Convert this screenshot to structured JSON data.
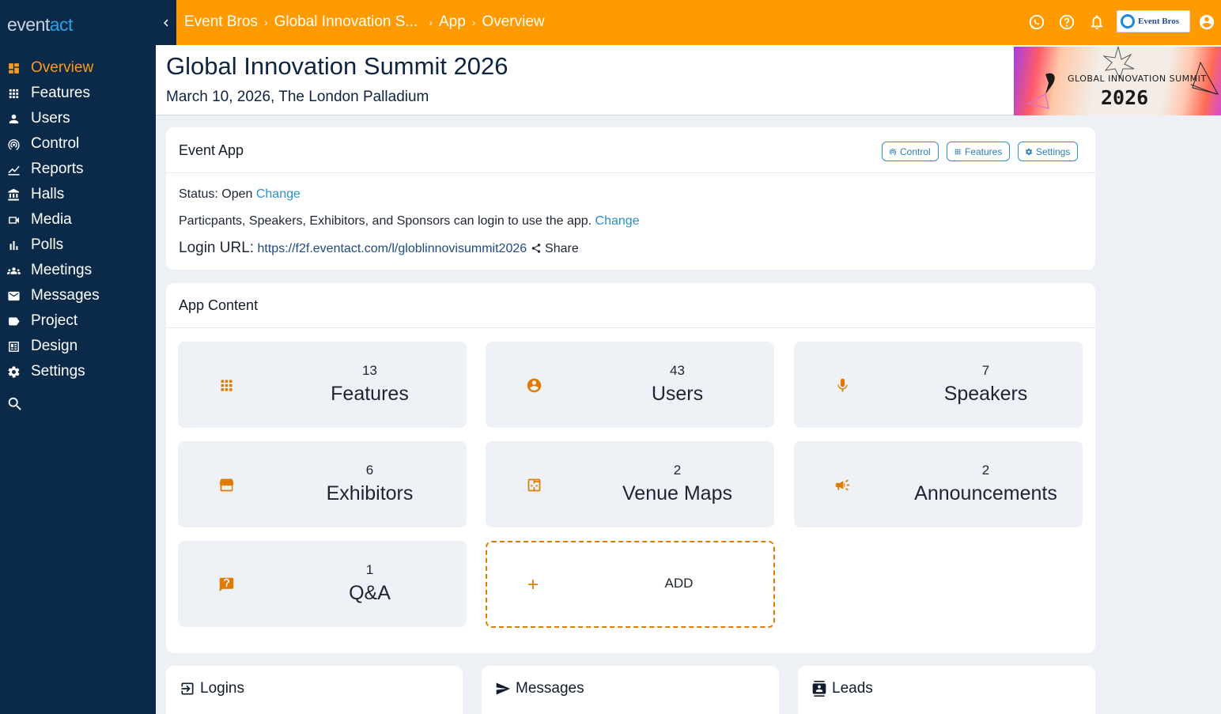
{
  "brand": {
    "logo_part1": "event",
    "logo_part2": "act"
  },
  "sidebar": {
    "items": [
      {
        "label": "Overview",
        "icon": "dashboard-icon",
        "active": true
      },
      {
        "label": "Features",
        "icon": "apps-grid-icon"
      },
      {
        "label": "Users",
        "icon": "person-icon"
      },
      {
        "label": "Control",
        "icon": "podcast-icon"
      },
      {
        "label": "Reports",
        "icon": "line-chart-icon"
      },
      {
        "label": "Halls",
        "icon": "bank-icon"
      },
      {
        "label": "Media",
        "icon": "video-camera-icon"
      },
      {
        "label": "Polls",
        "icon": "bar-chart-icon"
      },
      {
        "label": "Meetings",
        "icon": "group-icon"
      },
      {
        "label": "Messages",
        "icon": "mail-icon"
      },
      {
        "label": "Project",
        "icon": "label-icon"
      },
      {
        "label": "Design",
        "icon": "portrait-icon"
      },
      {
        "label": "Settings",
        "icon": "gear-icon"
      }
    ],
    "search_icon": "search-icon"
  },
  "topbar": {
    "breadcrumbs": [
      "Event Bros",
      "Global Innovation S...",
      "App",
      "Overview"
    ],
    "brand_box_label": "Event Bros",
    "icons": [
      "whatsapp-icon",
      "help-icon",
      "bell-icon",
      "account-icon"
    ],
    "accent_color": "#ff9a00"
  },
  "header": {
    "title": "Global Innovation Summit 2026",
    "subtitle": "March 10, 2026, The London Palladium",
    "banner_line1": "GLOBAL INNOVATION SUMMIT",
    "banner_line2": "2026"
  },
  "event_app": {
    "title": "Event App",
    "buttons": [
      "Control",
      "Features",
      "Settings"
    ],
    "status_label": "Status: Open",
    "status_change": "Change",
    "access_text": "Particpants, Speakers, Exhibitors, and Sponsors can login to use the app.",
    "access_change": "Change",
    "login_url_label": "Login URL:",
    "login_url": "https://f2f.eventact.com/l/globlinnovisummit2026",
    "share_label": "Share"
  },
  "app_content": {
    "title": "App Content",
    "tiles": [
      {
        "count": "13",
        "label": "Features",
        "icon": "apps-grid-icon"
      },
      {
        "count": "43",
        "label": "Users",
        "icon": "account-circle-icon"
      },
      {
        "count": "7",
        "label": "Speakers",
        "icon": "microphone-icon"
      },
      {
        "count": "6",
        "label": "Exhibitors",
        "icon": "storefront-icon"
      },
      {
        "count": "2",
        "label": "Venue Maps",
        "icon": "floor-plan-icon"
      },
      {
        "count": "2",
        "label": "Announcements",
        "icon": "megaphone-icon"
      },
      {
        "count": "1",
        "label": "Q&A",
        "icon": "question-bubble-icon"
      }
    ],
    "add_label": "ADD",
    "add_icon": "plus-icon"
  },
  "bottom_cards": [
    {
      "title": "Logins",
      "icon": "login-icon"
    },
    {
      "title": "Messages",
      "icon": "send-icon"
    },
    {
      "title": "Leads",
      "icon": "contacts-icon"
    }
  ]
}
